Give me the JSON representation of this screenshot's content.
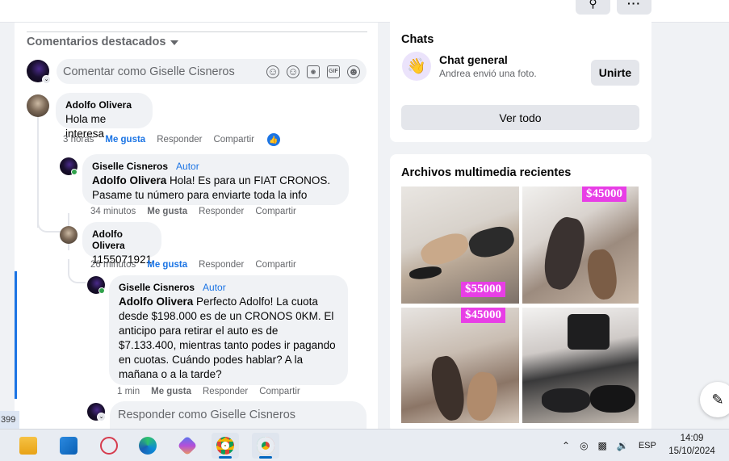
{
  "colors": {
    "accent": "#1b74e4",
    "author": "#1b74e4",
    "online": "#31a24c",
    "price_tag": "#e83ee6"
  },
  "feed": {
    "featured_label": "Comentarios destacados",
    "comment_placeholder": "Comentar como Giselle Cisneros",
    "reply_placeholder": "Responder como Giselle Cisneros",
    "comments": [
      {
        "author": "Adolfo Olivera",
        "text": "Hola me interesa",
        "time": "3 horas",
        "like": "Me gusta",
        "reply": "Responder",
        "share": "Compartir",
        "liked": true
      },
      {
        "author": "Giselle Cisneros",
        "badge": "Autor",
        "mention": "Adolfo Olivera",
        "text": " Hola! Es para un FIAT CRONOS. Pasame tu número para enviarte toda la info",
        "time": "34 minutos",
        "like": "Me gusta",
        "reply": "Responder",
        "share": "Compartir"
      },
      {
        "author": "Adolfo Olivera",
        "text": "1155071921",
        "time": "26 minutos",
        "like": "Me gusta",
        "reply": "Responder",
        "share": "Compartir"
      },
      {
        "author": "Giselle Cisneros",
        "badge": "Autor",
        "mention": "Adolfo Olivera",
        "text": " Perfecto Adolfo! La cuota desde $198.000 es de un CRONOS 0KM. El anticipo para retirar el auto es de $7.133.400, mientras tanto podes ir pagando en cuotas. Cuándo podes hablar? A la mañana o a la tarde?",
        "time": "1 min",
        "like": "Me gusta",
        "reply": "Responder",
        "share": "Compartir"
      }
    ]
  },
  "chats": {
    "title": "Chats",
    "group_name": "Chat general",
    "group_sub": "Andrea envió una foto.",
    "join_label": "Unirte",
    "see_all_label": "Ver todo"
  },
  "media": {
    "title": "Archivos multimedia recientes",
    "tags": [
      "$55000",
      "$45000",
      "$45000"
    ]
  },
  "side_number": "399",
  "taskbar": {
    "language": "ESP",
    "time": "14:09",
    "date": "15/10/2024"
  }
}
